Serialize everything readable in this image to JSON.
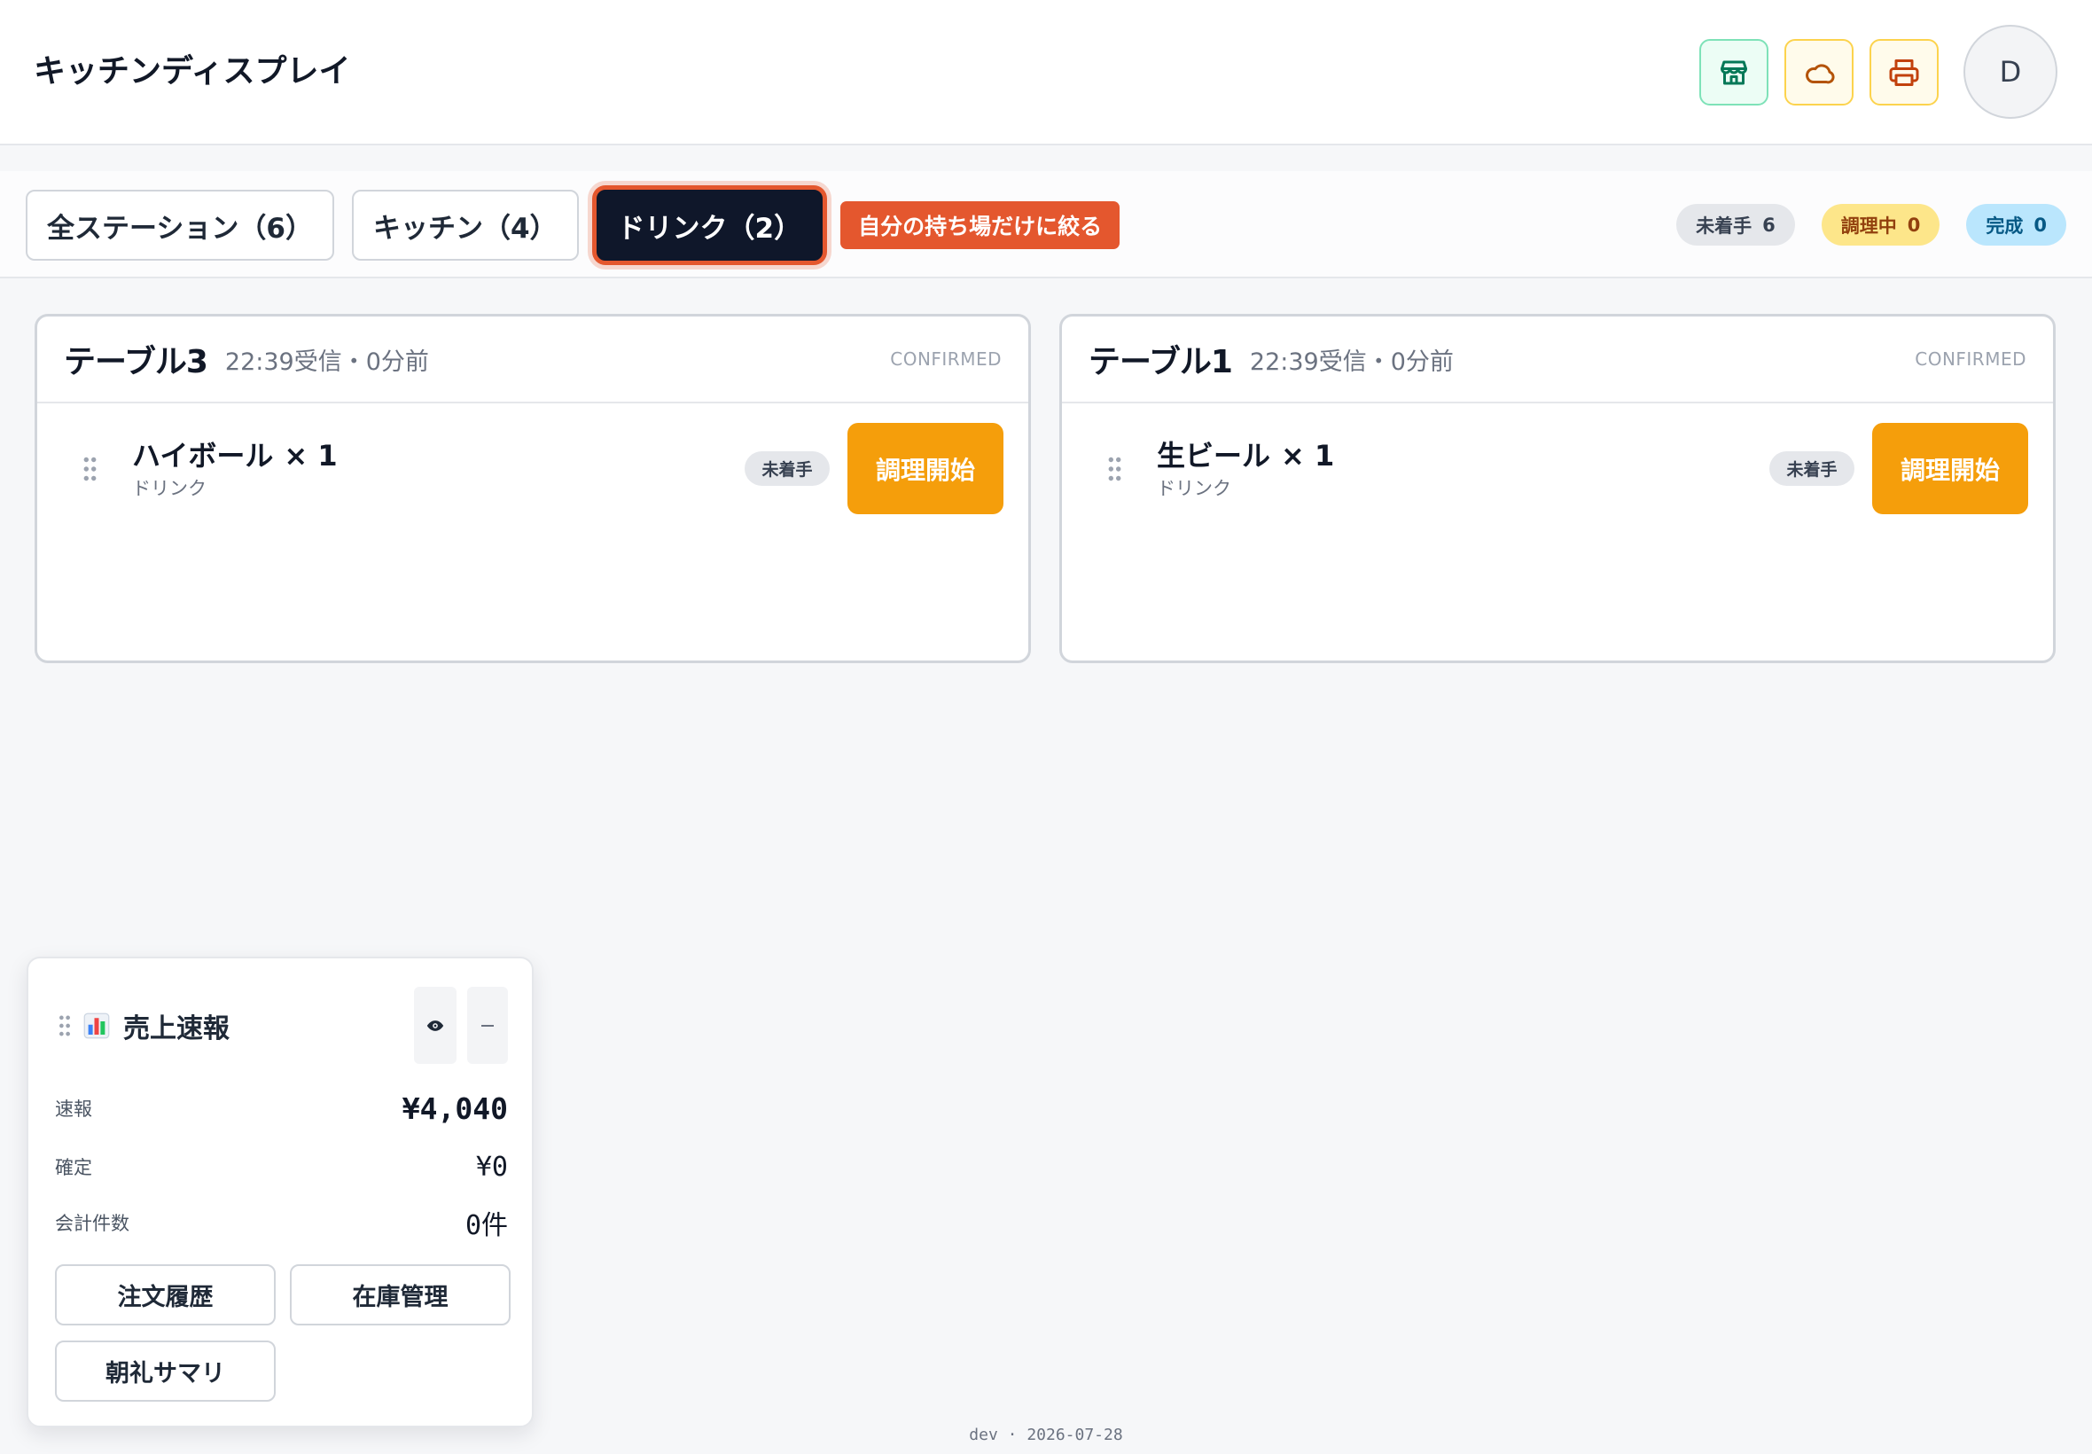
{
  "header": {
    "title": "キッチンディスプレイ",
    "avatar_initial": "D",
    "icons": [
      "store-icon",
      "cloud-icon",
      "printer-icon"
    ]
  },
  "filters": {
    "tabs": [
      {
        "label": "全ステーション（6）",
        "selected": false
      },
      {
        "label": "キッチン（4）",
        "selected": false
      },
      {
        "label": "ドリンク（2）",
        "selected": true
      }
    ],
    "mine_only_label": "自分の持ち場だけに絞る",
    "status_counts": [
      {
        "label": "未着手",
        "count": "6"
      },
      {
        "label": "調理中",
        "count": "0"
      },
      {
        "label": "完成",
        "count": "0"
      }
    ]
  },
  "orders": [
    {
      "table": "テーブル3",
      "received": "22:39受信・0分前",
      "status": "CONFIRMED",
      "items": [
        {
          "name": "ハイボール",
          "quantity": "× 1",
          "station": "ドリンク",
          "state": "未着手",
          "action": "調理開始"
        }
      ]
    },
    {
      "table": "テーブル1",
      "received": "22:39受信・0分前",
      "status": "CONFIRMED",
      "items": [
        {
          "name": "生ビール",
          "quantity": "× 1",
          "station": "ドリンク",
          "state": "未着手",
          "action": "調理開始"
        }
      ]
    }
  ],
  "sales_widget": {
    "title": "売上速報",
    "icon": "bar-chart-icon",
    "rows": [
      {
        "label": "速報",
        "value": "¥4,040"
      },
      {
        "label": "確定",
        "value": "¥0"
      },
      {
        "label": "会計件数",
        "value": "0件"
      }
    ],
    "buttons": [
      "注文履歴",
      "在庫管理",
      "朝礼サマリ"
    ]
  },
  "footer": {
    "build": "dev · 2026-07-28"
  },
  "colors": {
    "start_button": "#f59e0b",
    "mine_only_button": "#e4572e",
    "selected_tab": "#0f172a",
    "pending_pill": "#e5e7eb",
    "cooking_pill": "#fde68a",
    "done_pill": "#bae6fd"
  }
}
